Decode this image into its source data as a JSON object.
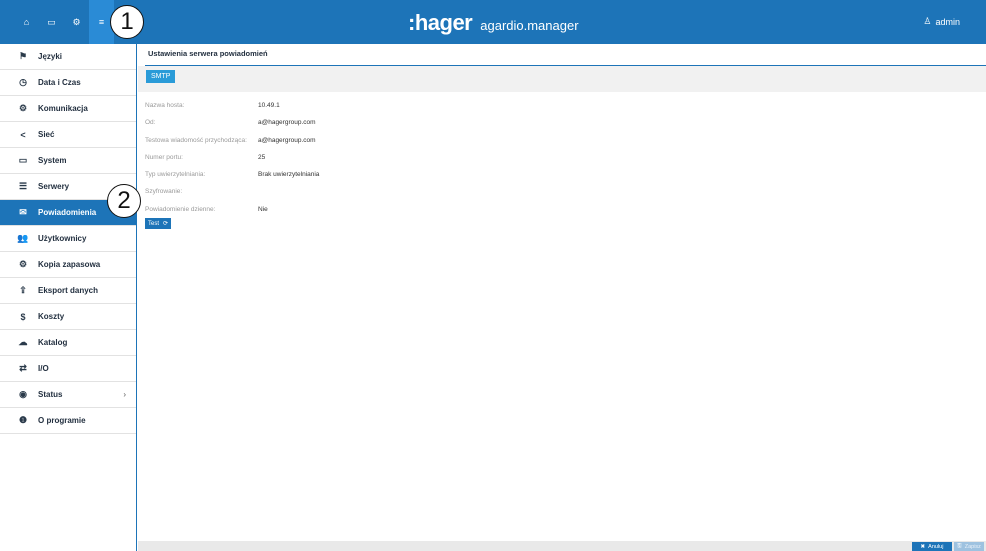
{
  "topbar": {
    "icons": [
      {
        "icon": "home-icon",
        "glyph": "⌂"
      },
      {
        "icon": "monitor-icon",
        "glyph": "▭"
      },
      {
        "icon": "cogs-icon",
        "glyph": "⚙"
      },
      {
        "icon": "sliders-icon",
        "glyph": "≡"
      }
    ],
    "brand_logo": ":hager",
    "brand_product": "agardio.manager",
    "user_name": "admin",
    "callout_1": "1",
    "callout_2": "2",
    "accent_color": "#1d74b8"
  },
  "sidebar": {
    "items": [
      {
        "label": "Języki",
        "icon": "flag-icon",
        "glyph": "⚑"
      },
      {
        "label": "Data i Czas",
        "icon": "clock-icon",
        "glyph": "◷"
      },
      {
        "label": "Komunikacja",
        "icon": "cogs-icon",
        "glyph": "⚙"
      },
      {
        "label": "Sieć",
        "icon": "share-icon",
        "glyph": "<"
      },
      {
        "label": "System",
        "icon": "hdd-icon",
        "glyph": "▭"
      },
      {
        "label": "Serwery",
        "icon": "server-icon",
        "glyph": "☰"
      },
      {
        "label": "Powiadomienia",
        "icon": "envelope-icon",
        "glyph": "✉"
      },
      {
        "label": "Użytkownicy",
        "icon": "users-icon",
        "glyph": "👥"
      },
      {
        "label": "Kopia zapasowa",
        "icon": "cogs-icon",
        "glyph": "⚙"
      },
      {
        "label": "Eksport danych",
        "icon": "upload-icon",
        "glyph": "⇪"
      },
      {
        "label": "Koszty",
        "icon": "dollar-icon",
        "glyph": "$"
      },
      {
        "label": "Katalog",
        "icon": "cloud-icon",
        "glyph": "☁"
      },
      {
        "label": "I/O",
        "icon": "exchange-icon",
        "glyph": "⇄"
      },
      {
        "label": "Status",
        "icon": "eye-icon",
        "glyph": "◉",
        "chevron": "›"
      },
      {
        "label": "O programie",
        "icon": "info-icon",
        "glyph": "❶"
      }
    ],
    "active_index": 6
  },
  "main": {
    "page_title": "Ustawienia serwera powiadomień",
    "tab_smtp": "SMTP",
    "fields": [
      {
        "label": "Nazwa hosta:",
        "value": "10.49.1"
      },
      {
        "label": "Od:",
        "value": "a@hagergroup.com"
      },
      {
        "label": "Testowa wiadomość przychodząca:",
        "value": "a@hagergroup.com"
      },
      {
        "label": "Numer portu:",
        "value": "25"
      },
      {
        "label": "Typ uwierzytelniania:",
        "value": "Brak uwierzytelniania"
      },
      {
        "label": "Szyfrowanie:",
        "value": ""
      },
      {
        "label": "Powiadomienie dzienne:",
        "value": "Nie"
      }
    ],
    "test_button": "Test",
    "refresh_glyph": "⟳"
  },
  "bottombar": {
    "cancel_label": "Anuluj",
    "cancel_glyph": "✖",
    "save_label": "Zapisz",
    "save_glyph": "🖫"
  }
}
